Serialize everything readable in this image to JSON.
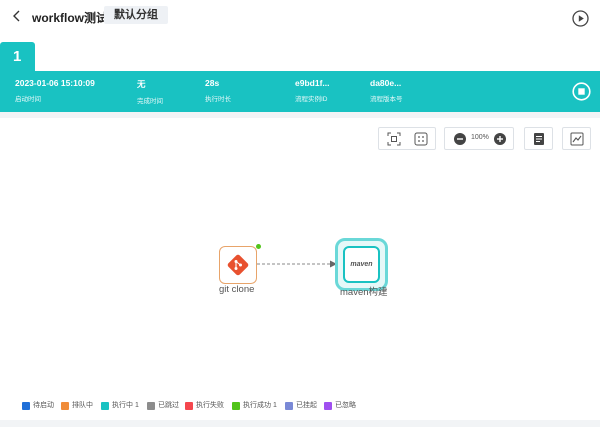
{
  "header": {
    "title": "workflow测试",
    "group": "默认分组"
  },
  "run_tab": "1",
  "run_info": [
    {
      "value": "2023-01-06 15:10:09",
      "label": "启动时间"
    },
    {
      "value": "无",
      "label": "完成时间"
    },
    {
      "value": "28s",
      "label": "执行时长"
    },
    {
      "value": "e9bd1f...",
      "label": "流程实例ID"
    },
    {
      "value": "da80e...",
      "label": "流程版本号"
    }
  ],
  "toolbar": {
    "zoom": "100%"
  },
  "nodes": {
    "git": {
      "label": "git clone",
      "icon": "git-icon"
    },
    "maven": {
      "label": "maven构建",
      "logo_text": "maven",
      "icon": "maven-icon"
    }
  },
  "legend": [
    {
      "label": "待启动",
      "color": "#1f6fd8"
    },
    {
      "label": "排队中",
      "color": "#f08c3a"
    },
    {
      "label": "执行中 1",
      "color": "#19c2c2"
    },
    {
      "label": "已跳过",
      "color": "#8c8c8c"
    },
    {
      "label": "执行失败",
      "color": "#f5474e"
    },
    {
      "label": "执行成功 1",
      "color": "#52c41a"
    },
    {
      "label": "已挂起",
      "color": "#7a89d6"
    },
    {
      "label": "已忽略",
      "color": "#a050f0"
    }
  ],
  "colors": {
    "accent": "#19c2c2",
    "git_orange": "#e8512f",
    "success": "#52c41a"
  }
}
